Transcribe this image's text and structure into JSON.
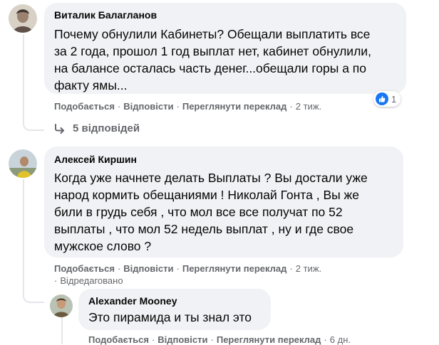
{
  "comments": [
    {
      "author": "Виталик Балагланов",
      "lines": [
        "Почему обнулили Кабинеты? Обещали выплатить все",
        "за 2 года, прошол 1 год выплат нет, кабинет обнулили,",
        "на балансе осталась часть денег...обещали горы а по",
        "факту ямы..."
      ],
      "reaction_count": "1",
      "like_label": "Подобається",
      "reply_label": "Відповісти",
      "translate_label": "Переглянути переклад",
      "time": "2 тиж."
    },
    {
      "author": "Алексей Киршин",
      "lines": [
        "Когда уже начнете делать Выплаты ? Вы достали уже",
        "народ кормить обещаниями ! Николай Гонта , Вы же",
        "били в грудь себя , что мол все все получат по 52",
        "выплаты , что мол 52 недель выплат , ну и где свое",
        "мужское слово ?"
      ],
      "like_label": "Подобається",
      "reply_label": "Відповісти",
      "translate_label": "Переглянути переклад",
      "time": "2 тиж.",
      "edited_label": "Відредаговано"
    }
  ],
  "replies_link": "5 відповідей",
  "reply": {
    "author": "Alexander Mooney",
    "text": "Это пирамида и ты знал это",
    "like_label": "Подобається",
    "reply_label": "Відповісти",
    "translate_label": "Переглянути переклад",
    "time": "6 дн."
  },
  "separator": "·",
  "colors": {
    "bubble": "#f0f2f5",
    "meta_text": "#65676b",
    "like_blue": "#1877f2",
    "thread_line": "#e4e6eb"
  },
  "icons": {
    "reply_arrow": "reply-arrow-icon",
    "like": "like-icon"
  }
}
